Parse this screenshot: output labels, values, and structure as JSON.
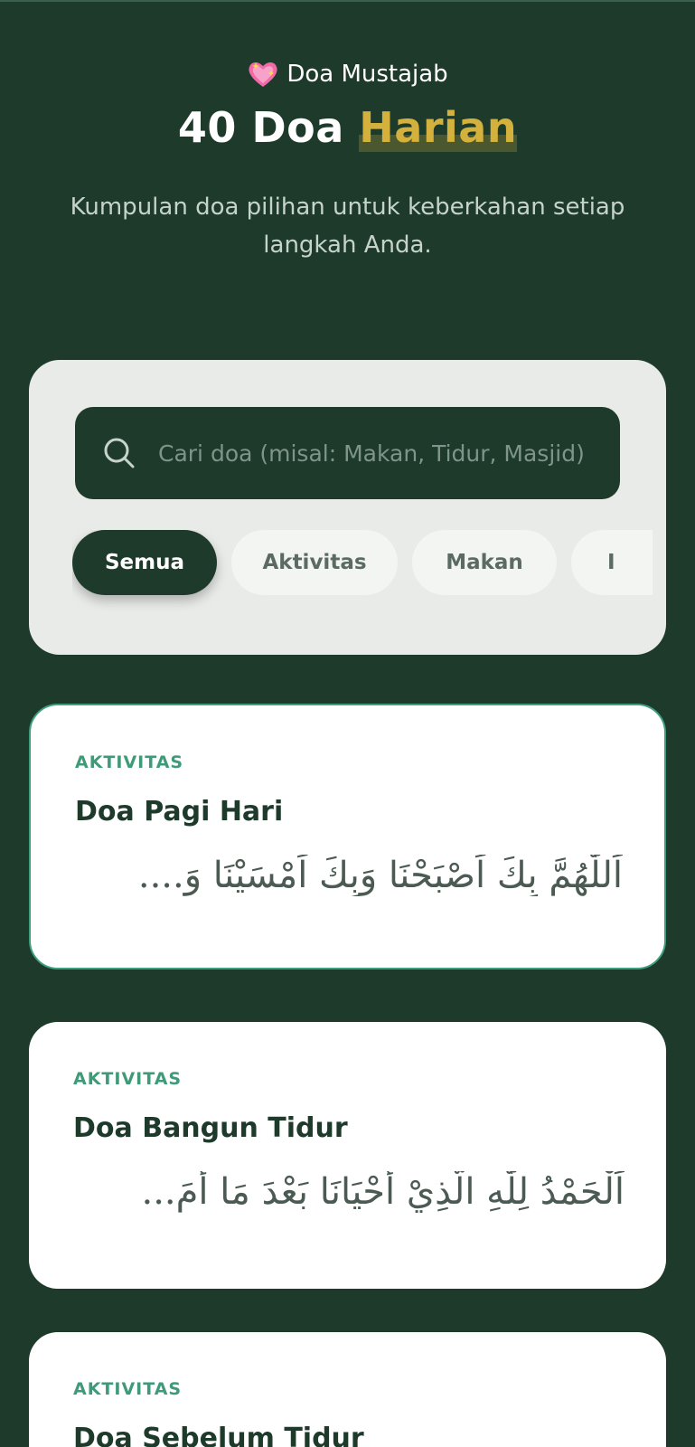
{
  "header": {
    "badge_text": "Doa Mustajab",
    "badge_icon": "sparkling-heart-icon",
    "title_main": "40 Doa",
    "title_accent": "Harian",
    "subtitle": "Kumpulan doa pilihan untuk keberkahan setiap langkah Anda."
  },
  "search": {
    "placeholder": "Cari doa (misal: Makan, Tidur, Masjid)",
    "value": ""
  },
  "chips": [
    {
      "label": "Semua",
      "active": true
    },
    {
      "label": "Aktivitas",
      "active": false
    },
    {
      "label": "Makan",
      "active": false
    },
    {
      "label": "I",
      "active": false
    }
  ],
  "cards": [
    {
      "category": "AKTIVITAS",
      "title": "Doa Pagi Hari",
      "arabic": "اَللّٰهُمَّ بِكَ اَصْبَحْنَا وَبِكَ اَمْسَيْنَا وَ...."
    },
    {
      "category": "AKTIVITAS",
      "title": "Doa Bangun Tidur",
      "arabic": "اَلْحَمْدُ لِلّٰهِ الَّذِيْ أَحْيَانَا بَعْدَ مَا أَمَ..."
    },
    {
      "category": "AKTIVITAS",
      "title": "Doa Sebelum Tidur",
      "arabic": ""
    }
  ],
  "colors": {
    "background": "#1d3a2b",
    "accent_gold": "#d4b13c",
    "category_green": "#3e9a78"
  }
}
